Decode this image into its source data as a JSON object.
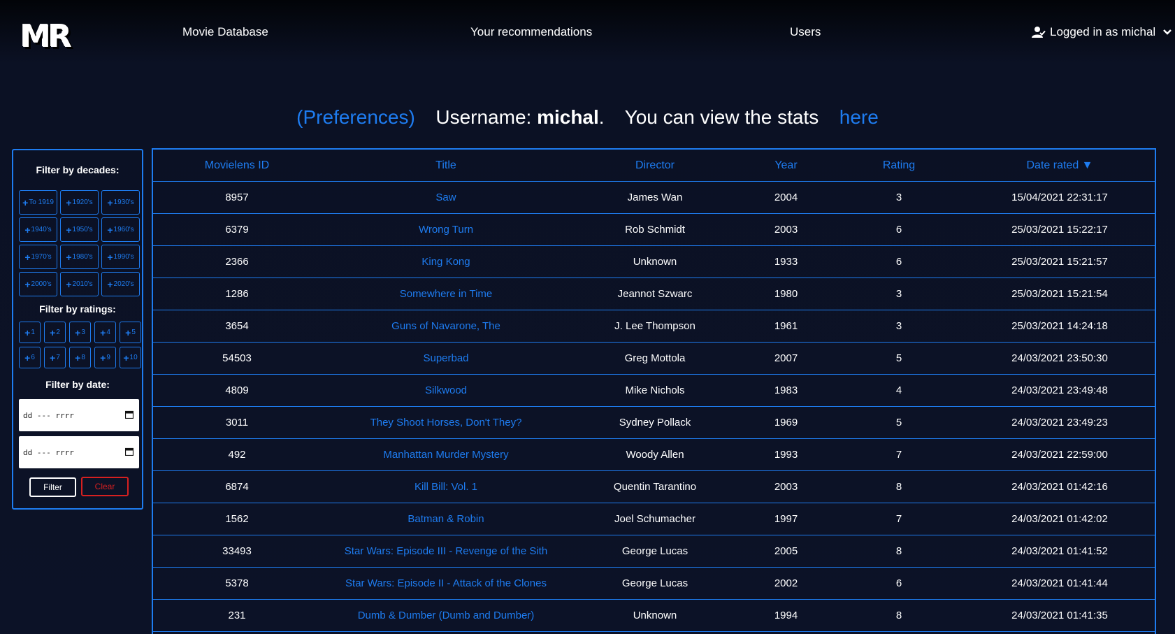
{
  "nav": {
    "logo": "MR",
    "movie_database": "Movie Database",
    "recommendations": "Your recommendations",
    "users": "Users",
    "logged_in": "Logged in as michal"
  },
  "info": {
    "preferences": "(Preferences)",
    "username_label": "Username:",
    "username": "michal",
    "period": ".",
    "stats_text": "You can view the stats",
    "here": "here"
  },
  "sidebar": {
    "decades_heading": "Filter by decades:",
    "decades": [
      "To 1919",
      "1920's",
      "1930's",
      "1940's",
      "1950's",
      "1960's",
      "1970's",
      "1980's",
      "1990's",
      "2000's",
      "2010's",
      "2020's"
    ],
    "ratings_heading": "Filter by ratings:",
    "ratings": [
      "1",
      "2",
      "3",
      "4",
      "5",
      "6",
      "7",
      "8",
      "9",
      "10"
    ],
    "date_heading": "Filter by date:",
    "date_from_placeholder": "dd --- rrrr",
    "date_to_placeholder": "dd --- rrrr",
    "filter_label": "Filter",
    "clear_label": "Clear"
  },
  "table": {
    "headers": [
      "Movielens ID",
      "Title",
      "Director",
      "Year",
      "Rating",
      "Date rated ▼"
    ],
    "rows": [
      {
        "id": "8957",
        "title": "Saw",
        "director": "James Wan",
        "year": "2004",
        "rating": "3",
        "date": "15/04/2021 22:31:17"
      },
      {
        "id": "6379",
        "title": "Wrong Turn",
        "director": "Rob Schmidt",
        "year": "2003",
        "rating": "6",
        "date": "25/03/2021 15:22:17"
      },
      {
        "id": "2366",
        "title": "King Kong",
        "director": "Unknown",
        "year": "1933",
        "rating": "6",
        "date": "25/03/2021 15:21:57"
      },
      {
        "id": "1286",
        "title": "Somewhere in Time",
        "director": "Jeannot Szwarc",
        "year": "1980",
        "rating": "3",
        "date": "25/03/2021 15:21:54"
      },
      {
        "id": "3654",
        "title": "Guns of Navarone, The",
        "director": "J. Lee Thompson",
        "year": "1961",
        "rating": "3",
        "date": "25/03/2021 14:24:18"
      },
      {
        "id": "54503",
        "title": "Superbad",
        "director": "Greg Mottola",
        "year": "2007",
        "rating": "5",
        "date": "24/03/2021 23:50:30"
      },
      {
        "id": "4809",
        "title": "Silkwood",
        "director": "Mike Nichols",
        "year": "1983",
        "rating": "4",
        "date": "24/03/2021 23:49:48"
      },
      {
        "id": "3011",
        "title": "They Shoot Horses, Don't They?",
        "director": "Sydney Pollack",
        "year": "1969",
        "rating": "5",
        "date": "24/03/2021 23:49:23"
      },
      {
        "id": "492",
        "title": "Manhattan Murder Mystery",
        "director": "Woody Allen",
        "year": "1993",
        "rating": "7",
        "date": "24/03/2021 22:59:00"
      },
      {
        "id": "6874",
        "title": "Kill Bill: Vol. 1",
        "director": "Quentin Tarantino",
        "year": "2003",
        "rating": "8",
        "date": "24/03/2021 01:42:16"
      },
      {
        "id": "1562",
        "title": "Batman & Robin",
        "director": "Joel Schumacher",
        "year": "1997",
        "rating": "7",
        "date": "24/03/2021 01:42:02"
      },
      {
        "id": "33493",
        "title": "Star Wars: Episode III - Revenge of the Sith",
        "director": "George Lucas",
        "year": "2005",
        "rating": "8",
        "date": "24/03/2021 01:41:52"
      },
      {
        "id": "5378",
        "title": "Star Wars: Episode II - Attack of the Clones",
        "director": "George Lucas",
        "year": "2002",
        "rating": "6",
        "date": "24/03/2021 01:41:44"
      },
      {
        "id": "231",
        "title": "Dumb & Dumber (Dumb and Dumber)",
        "director": "Unknown",
        "year": "1994",
        "rating": "8",
        "date": "24/03/2021 01:41:35"
      }
    ]
  },
  "colors": {
    "accent": "#1e7cf0",
    "background": "#0b1020",
    "clear": "#d62020"
  },
  "icons": {
    "user": "user-check-icon",
    "chevron": "chevron-down-icon",
    "plus": "plus-icon",
    "calendar": "calendar-icon"
  }
}
